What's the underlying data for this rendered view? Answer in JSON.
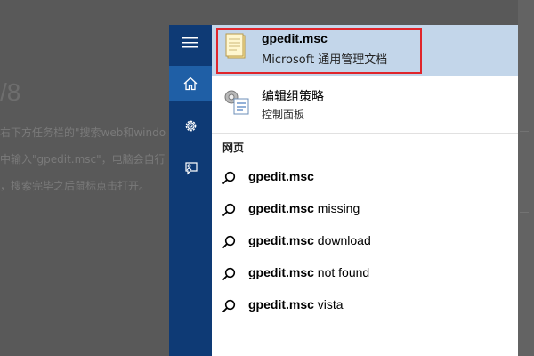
{
  "background": {
    "big_text": "/8",
    "lines": [
      "右下方任务栏的\"搜索web和windo",
      "中输入\"gpedit.msc\"，电脑会自行",
      "，搜索完毕之后鼠标点击打开。"
    ]
  },
  "rail": {
    "items": [
      {
        "name": "hamburger-icon"
      },
      {
        "name": "home-icon"
      },
      {
        "name": "settings-icon"
      },
      {
        "name": "feedback-icon"
      }
    ]
  },
  "results": {
    "top_hit": {
      "title": "gpedit.msc",
      "subtitle": "Microsoft 通用管理文档",
      "icon": "document-icon"
    },
    "app": {
      "title": "编辑组策略",
      "subtitle": "控制面板",
      "icon": "group-policy-icon"
    },
    "section_label": "网页",
    "suggestions": [
      {
        "bold": "gpedit.msc",
        "rest": ""
      },
      {
        "bold": "gpedit.msc",
        "rest": " missing"
      },
      {
        "bold": "gpedit.msc",
        "rest": " download"
      },
      {
        "bold": "gpedit.msc",
        "rest": " not found"
      },
      {
        "bold": "gpedit.msc",
        "rest": " vista"
      }
    ]
  },
  "colors": {
    "rail": "#0e3a75",
    "rail_active": "#1f5fa6",
    "top_hit_bg": "#c3d6ea",
    "highlight_border": "#e0252b"
  }
}
